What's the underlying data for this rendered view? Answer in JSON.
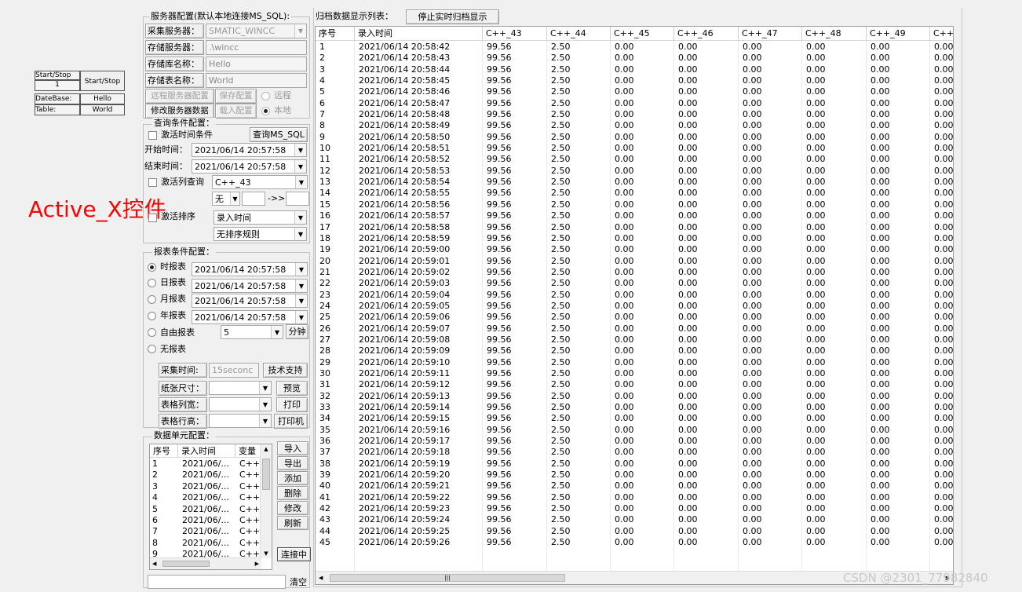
{
  "activex": {
    "start_stop_label": "Start/Stop",
    "start_stop_value": "1",
    "start_stop_button": "Start/Stop",
    "database_label": "DateBase:",
    "database_value": "Hello",
    "table_label": "Table:",
    "table_value": "World"
  },
  "annotation": "Active_X控件",
  "server": {
    "group_title": "服务器配置(默认本地连接MS_SQL):",
    "collect_label": "采集服务器：",
    "collect_value": "SMATIC_WINCC",
    "store_label": "存储服务器：",
    "store_value": ".\\wincc",
    "db_label": "存储库名称：",
    "db_value": "Hello",
    "table_label": "存储表名称：",
    "table_value": "World",
    "remote_config_btn": "远程服务器配置",
    "save_config_btn": "保存配置",
    "modify_btn": "修改服务器数据",
    "load_config_btn": "载入配置",
    "remote_radio": "远程",
    "local_radio": "本地"
  },
  "query": {
    "group_title": "查询条件配置：",
    "activate_time": "激活时间条件",
    "query_btn": "查询MS_SQL",
    "start_label": "开始时间：",
    "start_value": "2021/06/14 20:57:58",
    "end_label": "结束时间：",
    "end_value": "2021/06/14 20:57:58",
    "activate_column": "激活列查询",
    "column_value": "C++_43",
    "op_value": "无",
    "arrow_text": "->>",
    "activate_sort": "激活排序",
    "sort_field": "录入时间",
    "sort_rule": "无排序规则"
  },
  "report": {
    "group_title": "报表条件配置：",
    "hour": "时报表",
    "day": "日报表",
    "month": "月报表",
    "year": "年报表",
    "free": "自由报表",
    "none": "无报表",
    "hour_value": "2021/06/14 20:57:58",
    "day_value": "2021/06/14 20:57:58",
    "month_value": "2021/06/14 20:57:58",
    "year_value": "2021/06/14 20:57:58",
    "free_value": "5",
    "minute": "分钟",
    "collect_time_label": "采集时间:",
    "collect_time_value": "15seconc",
    "tech_btn": "技术支持",
    "paper_label": "纸张尺寸：",
    "preview_btn": "预览",
    "col_width_label": "表格列宽：",
    "print_btn": "打印",
    "row_height_label": "表格行高：",
    "printer_btn": "打印机"
  },
  "unit": {
    "group_title": "数据单元配置：",
    "headers": [
      "序号",
      "录入时间",
      "变量"
    ],
    "rows": [
      [
        "1",
        "2021/06/...",
        "C++"
      ],
      [
        "2",
        "2021/06/...",
        "C++"
      ],
      [
        "3",
        "2021/06/...",
        "C++"
      ],
      [
        "4",
        "2021/06/...",
        "C++"
      ],
      [
        "5",
        "2021/06/...",
        "C++"
      ],
      [
        "6",
        "2021/06/...",
        "C++"
      ],
      [
        "7",
        "2021/06/...",
        "C++"
      ],
      [
        "8",
        "2021/06/...",
        "C++"
      ],
      [
        "9",
        "2021/06/...",
        "C++"
      ]
    ],
    "import_btn": "导入",
    "export_btn": "导出",
    "add_btn": "添加",
    "delete_btn": "删除",
    "modify_btn": "修改",
    "refresh_btn": "刷新",
    "connecting_btn": "连接中",
    "clear_btn": "清空"
  },
  "archive": {
    "title": "归档数据显示列表：",
    "stop_btn": "停止实时归档显示",
    "headers": [
      "序号",
      "录入时间",
      "C++_43",
      "C++_44",
      "C++_45",
      "C++_46",
      "C++_47",
      "C++_48",
      "C++_49",
      "C++"
    ],
    "rows": [
      [
        "1",
        "2021/06/14 20:58:42",
        "99.56",
        "2.50",
        "0.00",
        "0.00",
        "0.00",
        "0.00",
        "0.00",
        "0.00"
      ],
      [
        "2",
        "2021/06/14 20:58:43",
        "99.56",
        "2.50",
        "0.00",
        "0.00",
        "0.00",
        "0.00",
        "0.00",
        "0.00"
      ],
      [
        "3",
        "2021/06/14 20:58:44",
        "99.56",
        "2.50",
        "0.00",
        "0.00",
        "0.00",
        "0.00",
        "0.00",
        "0.00"
      ],
      [
        "4",
        "2021/06/14 20:58:45",
        "99.56",
        "2.50",
        "0.00",
        "0.00",
        "0.00",
        "0.00",
        "0.00",
        "0.00"
      ],
      [
        "5",
        "2021/06/14 20:58:46",
        "99.56",
        "2.50",
        "0.00",
        "0.00",
        "0.00",
        "0.00",
        "0.00",
        "0.00"
      ],
      [
        "6",
        "2021/06/14 20:58:47",
        "99.56",
        "2.50",
        "0.00",
        "0.00",
        "0.00",
        "0.00",
        "0.00",
        "0.00"
      ],
      [
        "7",
        "2021/06/14 20:58:48",
        "99.56",
        "2.50",
        "0.00",
        "0.00",
        "0.00",
        "0.00",
        "0.00",
        "0.00"
      ],
      [
        "8",
        "2021/06/14 20:58:49",
        "99.56",
        "2.50",
        "0.00",
        "0.00",
        "0.00",
        "0.00",
        "0.00",
        "0.00"
      ],
      [
        "9",
        "2021/06/14 20:58:50",
        "99.56",
        "2.50",
        "0.00",
        "0.00",
        "0.00",
        "0.00",
        "0.00",
        "0.00"
      ],
      [
        "10",
        "2021/06/14 20:58:51",
        "99.56",
        "2.50",
        "0.00",
        "0.00",
        "0.00",
        "0.00",
        "0.00",
        "0.00"
      ],
      [
        "11",
        "2021/06/14 20:58:52",
        "99.56",
        "2.50",
        "0.00",
        "0.00",
        "0.00",
        "0.00",
        "0.00",
        "0.00"
      ],
      [
        "12",
        "2021/06/14 20:58:53",
        "99.56",
        "2.50",
        "0.00",
        "0.00",
        "0.00",
        "0.00",
        "0.00",
        "0.00"
      ],
      [
        "13",
        "2021/06/14 20:58:54",
        "99.56",
        "2.50",
        "0.00",
        "0.00",
        "0.00",
        "0.00",
        "0.00",
        "0.00"
      ],
      [
        "14",
        "2021/06/14 20:58:55",
        "99.56",
        "2.50",
        "0.00",
        "0.00",
        "0.00",
        "0.00",
        "0.00",
        "0.00"
      ],
      [
        "15",
        "2021/06/14 20:58:56",
        "99.56",
        "2.50",
        "0.00",
        "0.00",
        "0.00",
        "0.00",
        "0.00",
        "0.00"
      ],
      [
        "16",
        "2021/06/14 20:58:57",
        "99.56",
        "2.50",
        "0.00",
        "0.00",
        "0.00",
        "0.00",
        "0.00",
        "0.00"
      ],
      [
        "17",
        "2021/06/14 20:58:58",
        "99.56",
        "2.50",
        "0.00",
        "0.00",
        "0.00",
        "0.00",
        "0.00",
        "0.00"
      ],
      [
        "18",
        "2021/06/14 20:58:59",
        "99.56",
        "2.50",
        "0.00",
        "0.00",
        "0.00",
        "0.00",
        "0.00",
        "0.00"
      ],
      [
        "19",
        "2021/06/14 20:59:00",
        "99.56",
        "2.50",
        "0.00",
        "0.00",
        "0.00",
        "0.00",
        "0.00",
        "0.00"
      ],
      [
        "20",
        "2021/06/14 20:59:01",
        "99.56",
        "2.50",
        "0.00",
        "0.00",
        "0.00",
        "0.00",
        "0.00",
        "0.00"
      ],
      [
        "21",
        "2021/06/14 20:59:02",
        "99.56",
        "2.50",
        "0.00",
        "0.00",
        "0.00",
        "0.00",
        "0.00",
        "0.00"
      ],
      [
        "22",
        "2021/06/14 20:59:03",
        "99.56",
        "2.50",
        "0.00",
        "0.00",
        "0.00",
        "0.00",
        "0.00",
        "0.00"
      ],
      [
        "23",
        "2021/06/14 20:59:04",
        "99.56",
        "2.50",
        "0.00",
        "0.00",
        "0.00",
        "0.00",
        "0.00",
        "0.00"
      ],
      [
        "24",
        "2021/06/14 20:59:05",
        "99.56",
        "2.50",
        "0.00",
        "0.00",
        "0.00",
        "0.00",
        "0.00",
        "0.00"
      ],
      [
        "25",
        "2021/06/14 20:59:06",
        "99.56",
        "2.50",
        "0.00",
        "0.00",
        "0.00",
        "0.00",
        "0.00",
        "0.00"
      ],
      [
        "26",
        "2021/06/14 20:59:07",
        "99.56",
        "2.50",
        "0.00",
        "0.00",
        "0.00",
        "0.00",
        "0.00",
        "0.00"
      ],
      [
        "27",
        "2021/06/14 20:59:08",
        "99.56",
        "2.50",
        "0.00",
        "0.00",
        "0.00",
        "0.00",
        "0.00",
        "0.00"
      ],
      [
        "28",
        "2021/06/14 20:59:09",
        "99.56",
        "2.50",
        "0.00",
        "0.00",
        "0.00",
        "0.00",
        "0.00",
        "0.00"
      ],
      [
        "29",
        "2021/06/14 20:59:10",
        "99.56",
        "2.50",
        "0.00",
        "0.00",
        "0.00",
        "0.00",
        "0.00",
        "0.00"
      ],
      [
        "30",
        "2021/06/14 20:59:11",
        "99.56",
        "2.50",
        "0.00",
        "0.00",
        "0.00",
        "0.00",
        "0.00",
        "0.00"
      ],
      [
        "31",
        "2021/06/14 20:59:12",
        "99.56",
        "2.50",
        "0.00",
        "0.00",
        "0.00",
        "0.00",
        "0.00",
        "0.00"
      ],
      [
        "32",
        "2021/06/14 20:59:13",
        "99.56",
        "2.50",
        "0.00",
        "0.00",
        "0.00",
        "0.00",
        "0.00",
        "0.00"
      ],
      [
        "33",
        "2021/06/14 20:59:14",
        "99.56",
        "2.50",
        "0.00",
        "0.00",
        "0.00",
        "0.00",
        "0.00",
        "0.00"
      ],
      [
        "34",
        "2021/06/14 20:59:15",
        "99.56",
        "2.50",
        "0.00",
        "0.00",
        "0.00",
        "0.00",
        "0.00",
        "0.00"
      ],
      [
        "35",
        "2021/06/14 20:59:16",
        "99.56",
        "2.50",
        "0.00",
        "0.00",
        "0.00",
        "0.00",
        "0.00",
        "0.00"
      ],
      [
        "36",
        "2021/06/14 20:59:17",
        "99.56",
        "2.50",
        "0.00",
        "0.00",
        "0.00",
        "0.00",
        "0.00",
        "0.00"
      ],
      [
        "37",
        "2021/06/14 20:59:18",
        "99.56",
        "2.50",
        "0.00",
        "0.00",
        "0.00",
        "0.00",
        "0.00",
        "0.00"
      ],
      [
        "38",
        "2021/06/14 20:59:19",
        "99.56",
        "2.50",
        "0.00",
        "0.00",
        "0.00",
        "0.00",
        "0.00",
        "0.00"
      ],
      [
        "39",
        "2021/06/14 20:59:20",
        "99.56",
        "2.50",
        "0.00",
        "0.00",
        "0.00",
        "0.00",
        "0.00",
        "0.00"
      ],
      [
        "40",
        "2021/06/14 20:59:21",
        "99.56",
        "2.50",
        "0.00",
        "0.00",
        "0.00",
        "0.00",
        "0.00",
        "0.00"
      ],
      [
        "41",
        "2021/06/14 20:59:22",
        "99.56",
        "2.50",
        "0.00",
        "0.00",
        "0.00",
        "0.00",
        "0.00",
        "0.00"
      ],
      [
        "42",
        "2021/06/14 20:59:23",
        "99.56",
        "2.50",
        "0.00",
        "0.00",
        "0.00",
        "0.00",
        "0.00",
        "0.00"
      ],
      [
        "43",
        "2021/06/14 20:59:24",
        "99.56",
        "2.50",
        "0.00",
        "0.00",
        "0.00",
        "0.00",
        "0.00",
        "0.00"
      ],
      [
        "44",
        "2021/06/14 20:59:25",
        "99.56",
        "2.50",
        "0.00",
        "0.00",
        "0.00",
        "0.00",
        "0.00",
        "0.00"
      ],
      [
        "45",
        "2021/06/14 20:59:26",
        "99.56",
        "2.50",
        "0.00",
        "0.00",
        "0.00",
        "0.00",
        "0.00",
        "0.00"
      ]
    ]
  },
  "watermark": "CSDN @2301_77982840",
  "colors": {
    "annotation": "#ff0000",
    "window_bg": "#f0f0f0"
  }
}
